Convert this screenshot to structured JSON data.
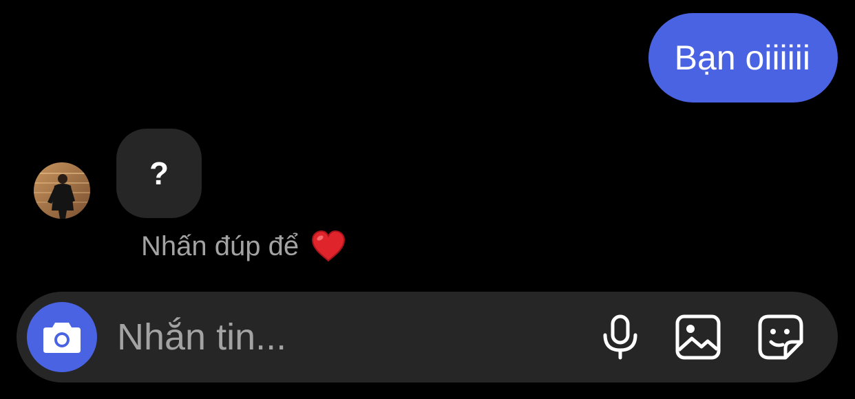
{
  "messages": {
    "outgoing_text": "Bạn oiiiiii",
    "incoming_text": "?",
    "hint_text": "Nhấn đúp để"
  },
  "icons": {
    "camera": "camera-icon",
    "microphone": "microphone-icon",
    "gallery": "image-icon",
    "sticker": "sticker-icon",
    "heart": "heart-icon"
  },
  "composer": {
    "placeholder": "Nhắn tin..."
  },
  "colors": {
    "background": "#000000",
    "accent": "#4a63e3",
    "incoming_bubble": "#262626",
    "muted_text": "#a3a3a3",
    "heart": "#e0242b"
  }
}
